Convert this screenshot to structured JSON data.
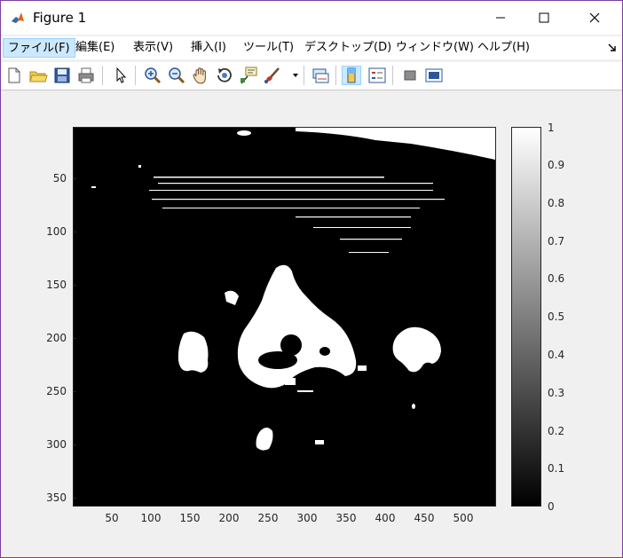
{
  "window": {
    "title": "Figure 1",
    "border_color": "#7a3e9d"
  },
  "menu": [
    {
      "label": "ファイル(F)",
      "active": true
    },
    {
      "label": "編集(E)"
    },
    {
      "label": "表示(V)"
    },
    {
      "label": "挿入(I)"
    },
    {
      "label": "ツール(T)"
    },
    {
      "label": "デスクトップ(D)"
    },
    {
      "label": "ウィンドウ(W)"
    },
    {
      "label": "ヘルプ(H)"
    }
  ],
  "toolbar": {
    "buttons": [
      {
        "name": "new-figure-icon"
      },
      {
        "name": "open-file-icon"
      },
      {
        "name": "save-icon"
      },
      {
        "name": "print-icon"
      },
      {
        "name": "pointer-icon"
      },
      {
        "name": "zoom-in-icon"
      },
      {
        "name": "zoom-out-icon"
      },
      {
        "name": "pan-icon"
      },
      {
        "name": "rotate-3d-icon"
      },
      {
        "name": "data-cursor-icon"
      },
      {
        "name": "brush-icon"
      },
      {
        "name": "link-plot-icon"
      },
      {
        "name": "colorbar-icon",
        "pressed": true
      },
      {
        "name": "legend-icon"
      },
      {
        "name": "hide-plot-tools-icon"
      },
      {
        "name": "show-plot-tools-icon"
      }
    ]
  },
  "chart_data": {
    "type": "heatmap",
    "colormap": "gray",
    "xlim": [
      1,
      540
    ],
    "ylim": [
      1,
      360
    ],
    "y_reversed": true,
    "x_ticks": [
      "50",
      "100",
      "150",
      "200",
      "250",
      "300",
      "350",
      "400",
      "450",
      "500"
    ],
    "y_ticks": [
      "50",
      "100",
      "150",
      "200",
      "250",
      "300",
      "350"
    ],
    "colorbar": {
      "range": [
        0,
        1
      ],
      "ticks": [
        "0",
        "0.1",
        "0.2",
        "0.3",
        "0.4",
        "0.5",
        "0.6",
        "0.7",
        "0.8",
        "0.9",
        "1"
      ]
    }
  }
}
